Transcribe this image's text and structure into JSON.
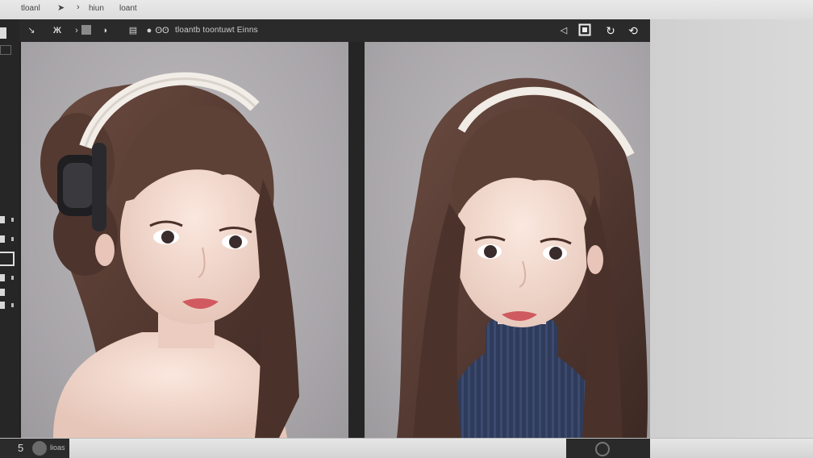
{
  "menubar": {
    "items": [
      "tloanl",
      "hiun",
      "loant"
    ],
    "arrow_icon": "cursor-arrow-icon",
    "chevron_icon": "chevron-right-icon"
  },
  "editor": {
    "title": "tloantb  toontuwt  Einns",
    "left_tools": [
      "pen-tool-icon",
      "brush-tool-icon",
      "color-swatch-icon",
      "layer-icon",
      "list-icon",
      "droplet-icon",
      "db-icon"
    ],
    "right_tools": [
      "back-arrow-icon",
      "frame-icon",
      "refresh-icon",
      "undo-icon"
    ]
  },
  "canvases": [
    {
      "name": "left-portrait",
      "subject": "woman with headphones"
    },
    {
      "name": "right-portrait",
      "subject": "woman in turtleneck sweater"
    }
  ],
  "statusbar": {
    "number": "5",
    "label": "lioas"
  },
  "colors": {
    "frame": "#202020",
    "canvas": "#aca9ad",
    "hair": "#5a3c32",
    "skin": "#f1d9cf",
    "sweater": "#2f3b5a"
  }
}
